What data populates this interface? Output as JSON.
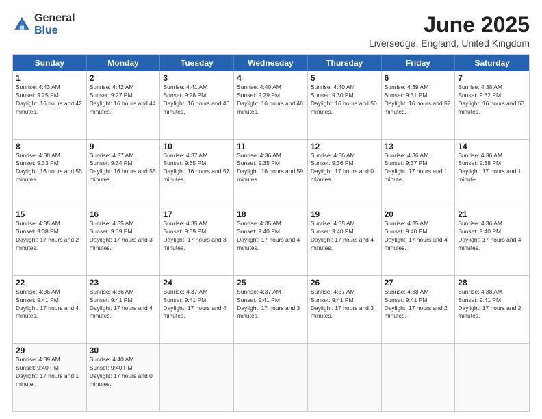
{
  "logo": {
    "general": "General",
    "blue": "Blue"
  },
  "title": {
    "month": "June 2025",
    "location": "Liversedge, England, United Kingdom"
  },
  "weekdays": [
    "Sunday",
    "Monday",
    "Tuesday",
    "Wednesday",
    "Thursday",
    "Friday",
    "Saturday"
  ],
  "rows": [
    [
      {
        "day": "1",
        "sunrise": "4:43 AM",
        "sunset": "9:25 PM",
        "daylight": "16 hours and 42 minutes."
      },
      {
        "day": "2",
        "sunrise": "4:42 AM",
        "sunset": "9:27 PM",
        "daylight": "16 hours and 44 minutes."
      },
      {
        "day": "3",
        "sunrise": "4:41 AM",
        "sunset": "9:28 PM",
        "daylight": "16 hours and 46 minutes."
      },
      {
        "day": "4",
        "sunrise": "4:40 AM",
        "sunset": "9:29 PM",
        "daylight": "16 hours and 48 minutes."
      },
      {
        "day": "5",
        "sunrise": "4:40 AM",
        "sunset": "9:30 PM",
        "daylight": "16 hours and 50 minutes."
      },
      {
        "day": "6",
        "sunrise": "4:39 AM",
        "sunset": "9:31 PM",
        "daylight": "16 hours and 52 minutes."
      },
      {
        "day": "7",
        "sunrise": "4:38 AM",
        "sunset": "9:32 PM",
        "daylight": "16 hours and 53 minutes."
      }
    ],
    [
      {
        "day": "8",
        "sunrise": "4:38 AM",
        "sunset": "9:33 PM",
        "daylight": "16 hours and 55 minutes."
      },
      {
        "day": "9",
        "sunrise": "4:37 AM",
        "sunset": "9:34 PM",
        "daylight": "16 hours and 56 minutes."
      },
      {
        "day": "10",
        "sunrise": "4:37 AM",
        "sunset": "9:35 PM",
        "daylight": "16 hours and 57 minutes."
      },
      {
        "day": "11",
        "sunrise": "4:36 AM",
        "sunset": "9:35 PM",
        "daylight": "16 hours and 59 minutes."
      },
      {
        "day": "12",
        "sunrise": "4:36 AM",
        "sunset": "9:36 PM",
        "daylight": "17 hours and 0 minutes."
      },
      {
        "day": "13",
        "sunrise": "4:36 AM",
        "sunset": "9:37 PM",
        "daylight": "17 hours and 1 minute."
      },
      {
        "day": "14",
        "sunrise": "4:36 AM",
        "sunset": "9:38 PM",
        "daylight": "17 hours and 1 minute."
      }
    ],
    [
      {
        "day": "15",
        "sunrise": "4:35 AM",
        "sunset": "9:38 PM",
        "daylight": "17 hours and 2 minutes."
      },
      {
        "day": "16",
        "sunrise": "4:35 AM",
        "sunset": "9:39 PM",
        "daylight": "17 hours and 3 minutes."
      },
      {
        "day": "17",
        "sunrise": "4:35 AM",
        "sunset": "9:39 PM",
        "daylight": "17 hours and 3 minutes."
      },
      {
        "day": "18",
        "sunrise": "4:35 AM",
        "sunset": "9:40 PM",
        "daylight": "17 hours and 4 minutes."
      },
      {
        "day": "19",
        "sunrise": "4:35 AM",
        "sunset": "9:40 PM",
        "daylight": "17 hours and 4 minutes."
      },
      {
        "day": "20",
        "sunrise": "4:35 AM",
        "sunset": "9:40 PM",
        "daylight": "17 hours and 4 minutes."
      },
      {
        "day": "21",
        "sunrise": "4:36 AM",
        "sunset": "9:40 PM",
        "daylight": "17 hours and 4 minutes."
      }
    ],
    [
      {
        "day": "22",
        "sunrise": "4:36 AM",
        "sunset": "9:41 PM",
        "daylight": "17 hours and 4 minutes."
      },
      {
        "day": "23",
        "sunrise": "4:36 AM",
        "sunset": "9:41 PM",
        "daylight": "17 hours and 4 minutes."
      },
      {
        "day": "24",
        "sunrise": "4:37 AM",
        "sunset": "9:41 PM",
        "daylight": "17 hours and 4 minutes."
      },
      {
        "day": "25",
        "sunrise": "4:37 AM",
        "sunset": "9:41 PM",
        "daylight": "17 hours and 3 minutes."
      },
      {
        "day": "26",
        "sunrise": "4:37 AM",
        "sunset": "9:41 PM",
        "daylight": "17 hours and 3 minutes."
      },
      {
        "day": "27",
        "sunrise": "4:38 AM",
        "sunset": "9:41 PM",
        "daylight": "17 hours and 2 minutes."
      },
      {
        "day": "28",
        "sunrise": "4:38 AM",
        "sunset": "9:41 PM",
        "daylight": "17 hours and 2 minutes."
      }
    ],
    [
      {
        "day": "29",
        "sunrise": "4:39 AM",
        "sunset": "9:40 PM",
        "daylight": "17 hours and 1 minute."
      },
      {
        "day": "30",
        "sunrise": "4:40 AM",
        "sunset": "9:40 PM",
        "daylight": "17 hours and 0 minutes."
      },
      null,
      null,
      null,
      null,
      null
    ]
  ]
}
